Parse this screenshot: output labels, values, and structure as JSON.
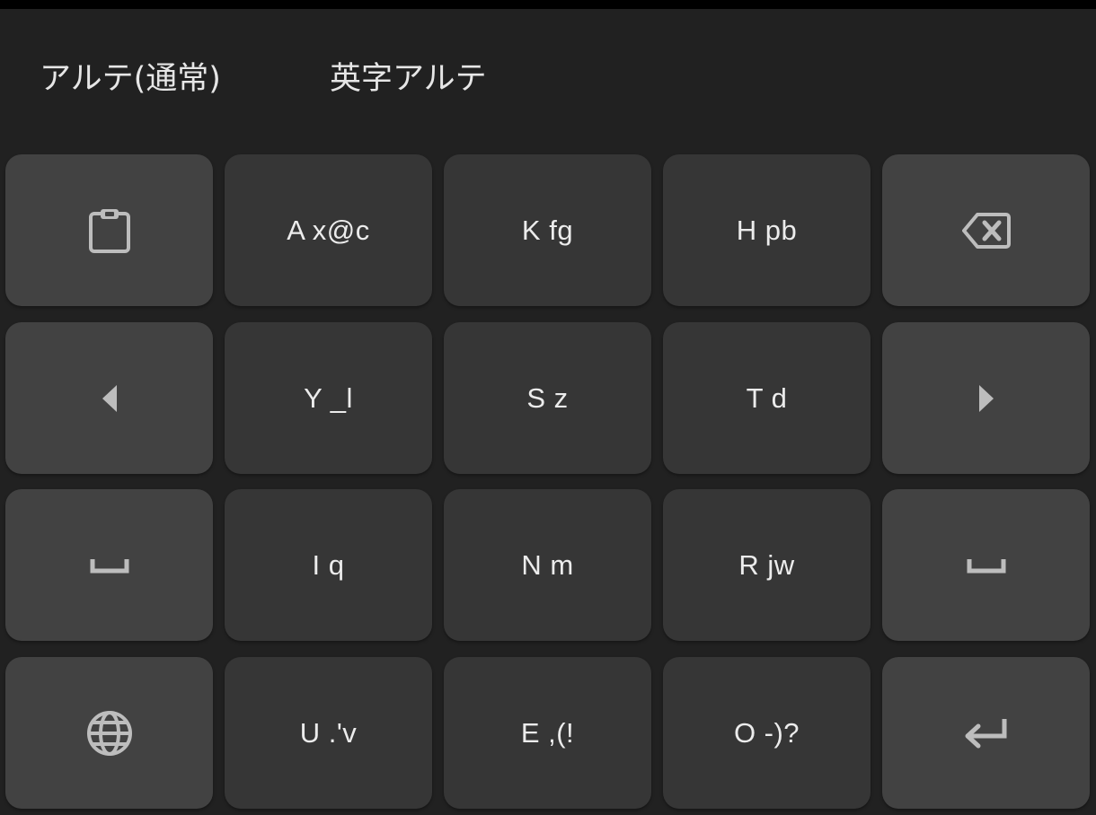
{
  "suggestions": [
    {
      "label": "アルテ(通常)"
    },
    {
      "label": "英字アルテ"
    }
  ],
  "keyboard": {
    "icon_color": "#bdbdbd",
    "rows": [
      {
        "keys": [
          {
            "type": "func",
            "icon": "clipboard-icon"
          },
          {
            "type": "char",
            "label": "A x@c"
          },
          {
            "type": "char",
            "label": "K fg"
          },
          {
            "type": "char",
            "label": "H pb"
          },
          {
            "type": "func",
            "icon": "backspace-icon"
          }
        ]
      },
      {
        "keys": [
          {
            "type": "func",
            "icon": "cursor-left-icon"
          },
          {
            "type": "char",
            "label": "Y _l"
          },
          {
            "type": "char",
            "label": "S z"
          },
          {
            "type": "char",
            "label": "T d"
          },
          {
            "type": "func",
            "icon": "cursor-right-icon"
          }
        ]
      },
      {
        "keys": [
          {
            "type": "func",
            "icon": "space-icon"
          },
          {
            "type": "char",
            "label": "I q"
          },
          {
            "type": "char",
            "label": "N m"
          },
          {
            "type": "char",
            "label": "R jw"
          },
          {
            "type": "func",
            "icon": "space-icon"
          }
        ]
      },
      {
        "keys": [
          {
            "type": "func",
            "icon": "globe-icon"
          },
          {
            "type": "char",
            "label": "U .'v"
          },
          {
            "type": "char",
            "label": "E ,(!"
          },
          {
            "type": "char",
            "label": "O -)?"
          },
          {
            "type": "func",
            "icon": "enter-icon"
          }
        ]
      }
    ]
  }
}
